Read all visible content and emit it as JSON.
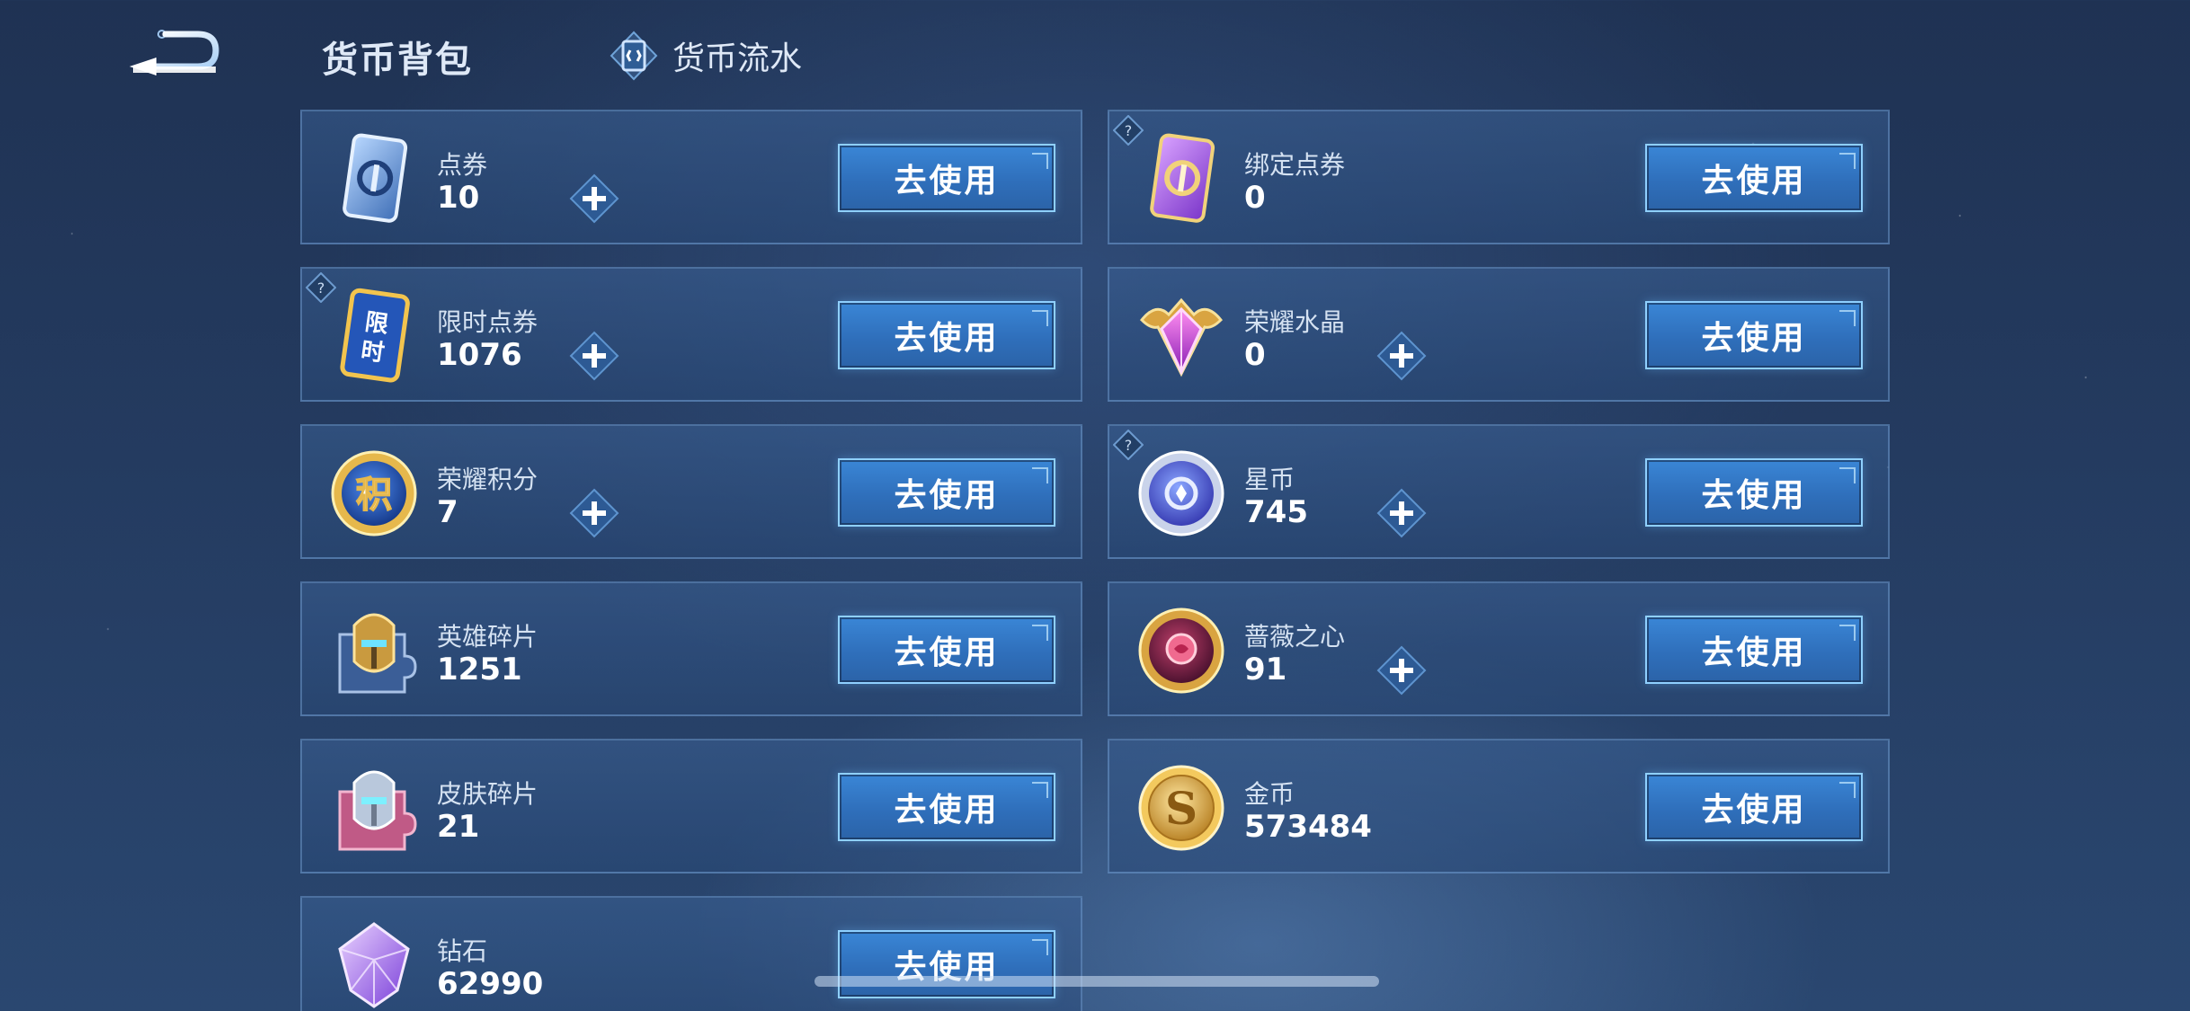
{
  "header": {
    "title": "货币背包",
    "flow_label": "货币流水"
  },
  "cards": [
    {
      "name": "点券",
      "value": "10",
      "button": "去使用",
      "icon": "ticket-blue-icon",
      "has_plus": true,
      "has_help": false
    },
    {
      "name": "绑定点券",
      "value": "0",
      "button": "去使用",
      "icon": "ticket-purple-icon",
      "has_plus": false,
      "has_help": true
    },
    {
      "name": "限时点券",
      "value": "1076",
      "button": "去使用",
      "icon": "limited-ticket-icon",
      "icon_text": "限时",
      "has_plus": true,
      "has_help": true
    },
    {
      "name": "荣耀水晶",
      "value": "0",
      "button": "去使用",
      "icon": "glory-crystal-icon",
      "has_plus": true,
      "has_help": false
    },
    {
      "name": "荣耀积分",
      "value": "7",
      "button": "去使用",
      "icon": "points-coin-icon",
      "icon_text": "积",
      "has_plus": true,
      "has_help": false
    },
    {
      "name": "星币",
      "value": "745",
      "button": "去使用",
      "icon": "star-coin-icon",
      "has_plus": true,
      "has_help": true
    },
    {
      "name": "英雄碎片",
      "value": "1251",
      "button": "去使用",
      "icon": "hero-fragment-icon",
      "has_plus": false,
      "has_help": false
    },
    {
      "name": "蔷薇之心",
      "value": "91",
      "button": "去使用",
      "icon": "rose-heart-icon",
      "has_plus": true,
      "has_help": false
    },
    {
      "name": "皮肤碎片",
      "value": "21",
      "button": "去使用",
      "icon": "skin-fragment-icon",
      "has_plus": false,
      "has_help": false
    },
    {
      "name": "金币",
      "value": "573484",
      "button": "去使用",
      "icon": "gold-coin-icon",
      "icon_text": "S",
      "has_plus": false,
      "has_help": false
    },
    {
      "name": "钻石",
      "value": "62990",
      "button": "去使用",
      "icon": "diamond-icon",
      "has_plus": false,
      "has_help": false
    }
  ],
  "colors": {
    "accent": "#3a86d6",
    "button_border": "#8fd0ff",
    "background": "#243b60"
  }
}
